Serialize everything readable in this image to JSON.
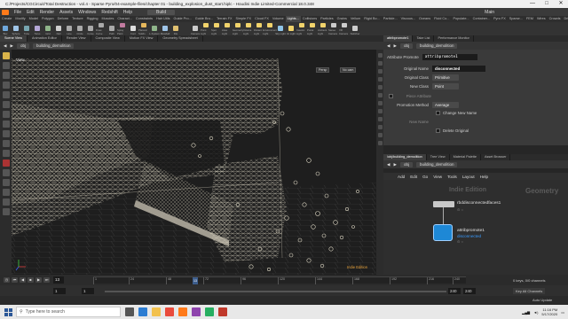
{
  "window": {
    "title": "C:/Projects/CGCircuit/Total Destruction - vol.4 - Sparse Pyro/04-example-files/chapter 01 - building_explosion_dust_start.hiplc - Houdini Indie Limited-Commercial 18.0.348",
    "minimize": "—",
    "maximize": "□",
    "close": "✕"
  },
  "menubar": {
    "items": [
      "File",
      "Edit",
      "Render",
      "Assets",
      "Windows",
      "Redshift",
      "Help"
    ],
    "desktop": "Build",
    "main_label": "Main"
  },
  "shelf_tabs": [
    "Create",
    "Modify",
    "Model",
    "Polygon",
    "Deform",
    "Texture",
    "Rigging",
    "Muscles",
    "Charact...",
    "Constraints",
    "Hair Utils",
    "Guide Pro...",
    "Guide Bru...",
    "Terrain FX",
    "Simple FX",
    "Cloud FX",
    "Volume",
    "Lights...",
    "Collisions",
    "Particles",
    "Grains",
    "Vellum",
    "Rigid Bo...",
    "Particle...",
    "Viscous...",
    "Oceans",
    "Fluid Co...",
    "Populate...",
    "Container...",
    "Pyro FX",
    "Sparse...",
    "FEM",
    "Wires",
    "Crowds",
    "Drive Si..."
  ],
  "shelf_tools": {
    "left": [
      "Box",
      "Sphere",
      "Tube",
      "Torus",
      "Grid",
      "Null",
      "Line",
      "Circle",
      "Curve",
      "Draw Curve",
      "Path",
      "Spray Paint",
      "Font",
      "Platonic Solids",
      "L-System",
      "Metaball",
      "File"
    ],
    "right": [
      "Camera",
      "Point Light",
      "Spot Light",
      "Area Light",
      "Geometry Light",
      "Volume Light",
      "Distant Light",
      "Environment Light",
      "Sky Light",
      "GI Light",
      "Caustic Light",
      "Portal Light",
      "Ambient Light",
      "Stereo Camera",
      "VR Camera",
      "Switcher"
    ]
  },
  "left_pane": {
    "tabs": [
      "Scene View",
      "Animation Editor",
      "Render View",
      "Composite View",
      "Motion FX View",
      "Geometry Spreadsheet"
    ],
    "path": [
      "obj",
      "building_demolition"
    ],
    "viewport_label": "View",
    "persp": "Persp",
    "cam": "No cam",
    "edition": "Indie Edition"
  },
  "param_pane": {
    "tabs": [
      "attribpromote1",
      "Take List",
      "Performance Monitor"
    ],
    "path": [
      "obj",
      "building_demolition"
    ],
    "node_type": "Attribute Promote",
    "node_name": "attribpromote1",
    "rows": {
      "original_name": {
        "label": "Original Name",
        "value": "disconnected"
      },
      "original_class": {
        "label": "Original Class",
        "value": "Primitive"
      },
      "new_class": {
        "label": "New Class",
        "value": "Point"
      },
      "piece_attr": {
        "label": "Piece Attribute"
      },
      "promotion_method": {
        "label": "Promotion Method",
        "value": "Average"
      },
      "change_new_name": {
        "label": "Change New Name"
      },
      "new_name": {
        "label": "New Name"
      },
      "delete_original": {
        "label": "Delete Original"
      }
    }
  },
  "network_pane": {
    "tabs": [
      "/obj/building_demolition",
      "Tree View",
      "Material Palette",
      "Asset Browser"
    ],
    "path": [
      "obj",
      "building_demolition"
    ],
    "menu": [
      "Add",
      "Edit",
      "Go",
      "View",
      "Tools",
      "Layout",
      "Help"
    ],
    "watermark_edition": "Indie Edition",
    "watermark_context": "Geometry",
    "nodes": [
      {
        "name": "rbddisconnectedfaces1",
        "sub": ""
      },
      {
        "name": "attribpromote1",
        "sub": "disconnected"
      }
    ]
  },
  "timeline": {
    "frame": "13",
    "playhead": "13",
    "ticks": [
      "1",
      "24",
      "48",
      "72",
      "96",
      "120",
      "144",
      "168",
      "192",
      "216",
      "240"
    ],
    "keys_label": "0 keys, 0/0 channels"
  },
  "range": {
    "start": "1",
    "start2": "1",
    "end": "240",
    "end2": "240",
    "all_channels": "Key All Channels"
  },
  "status": {
    "auto_update": "Auto Update"
  },
  "taskbar": {
    "search_placeholder": "Type here to search",
    "time": "11:16 PM",
    "date": "5/17/2020"
  }
}
